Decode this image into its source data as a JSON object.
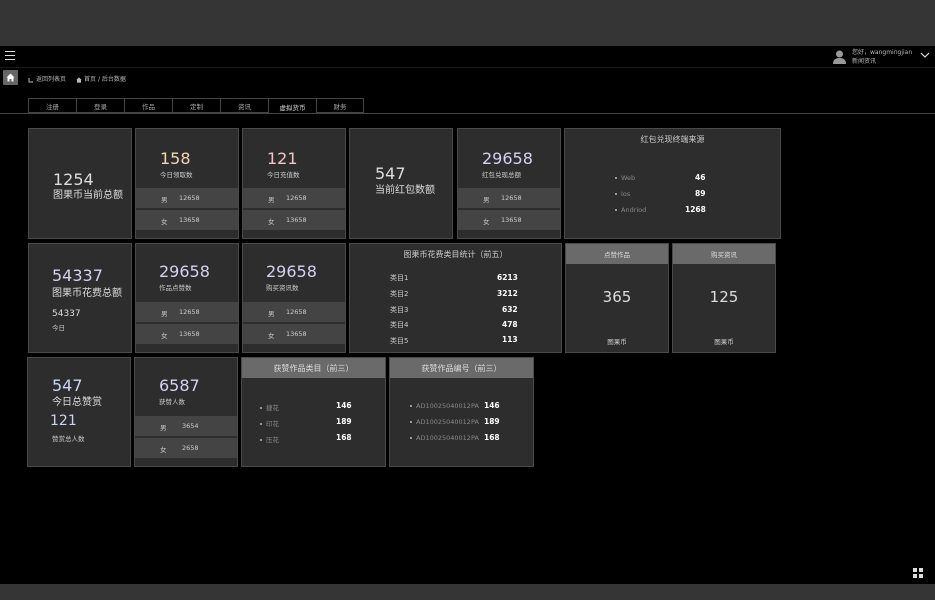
{
  "header": {
    "greeting": "您好，wangmingjian",
    "subtitle": "新闻资讯"
  },
  "breadcrumb": {
    "back": "返回列表页",
    "home": "首页",
    "separator": "/",
    "current": "后台数据"
  },
  "tabs": [
    "注册",
    "登录",
    "作品",
    "定制",
    "资讯",
    "虚拟货币",
    "财务"
  ],
  "cards": {
    "c1": {
      "value": "1254",
      "label": "图果币当前总额"
    },
    "c2": {
      "value": "158",
      "label": "今日领取数",
      "male_label": "男",
      "male": "12658",
      "female_label": "女",
      "female": "13658"
    },
    "c3": {
      "value": "121",
      "label": "今日充值数",
      "male_label": "男",
      "male": "12658",
      "female_label": "女",
      "female": "13658"
    },
    "c4": {
      "value": "547",
      "label": "当前红包数额"
    },
    "c5": {
      "value": "29658",
      "label": "红包兑现总额",
      "male_label": "男",
      "male": "12658",
      "female_label": "女",
      "female": "13658"
    },
    "c6": {
      "title": "红包兑现终端来源",
      "items": [
        {
          "name": "Web",
          "value": "46"
        },
        {
          "name": "Ios",
          "value": "89"
        },
        {
          "name": "Andriod",
          "value": "1268"
        }
      ]
    },
    "c7": {
      "value": "54337",
      "label": "图果币花费总额",
      "sub_value": "54337",
      "sub_label": "今日"
    },
    "c8": {
      "value": "29658",
      "label": "作品点赞数",
      "male_label": "男",
      "male": "12658",
      "female_label": "女",
      "female": "13658"
    },
    "c9": {
      "value": "29658",
      "label": "购买资讯数",
      "male_label": "男",
      "male": "12658",
      "female_label": "女",
      "female": "13658"
    },
    "c10": {
      "title": "图果币花费类目统计（前五）",
      "items": [
        {
          "name": "类目1",
          "value": "6213"
        },
        {
          "name": "类目2",
          "value": "3212"
        },
        {
          "name": "类目3",
          "value": "632"
        },
        {
          "name": "类目4",
          "value": "478"
        },
        {
          "name": "类目5",
          "value": "113"
        }
      ]
    },
    "c11": {
      "header": "点赞作品",
      "value": "365",
      "unit": "图果币"
    },
    "c12": {
      "header": "购买资讯",
      "value": "125",
      "unit": "图果币"
    },
    "c13": {
      "value": "547",
      "label": "今日总赞赏",
      "sub_value": "121",
      "sub_label": "赞赏总人数"
    },
    "c14": {
      "value": "6587",
      "label": "获赞人数",
      "male_label": "男",
      "male": "3654",
      "female_label": "女",
      "female": "2658"
    },
    "c15": {
      "title": "获赞作品类目（前三）",
      "items": [
        {
          "name": "捷花",
          "value": "146"
        },
        {
          "name": "印花",
          "value": "189"
        },
        {
          "name": "压花",
          "value": "168"
        }
      ]
    },
    "c16": {
      "title": "获赞作品编号（前三）",
      "items": [
        {
          "name": "AD10025040012PA",
          "value": "146"
        },
        {
          "name": "AD10025040012PA",
          "value": "189"
        },
        {
          "name": "AD10025040012PA",
          "value": "168"
        }
      ]
    }
  },
  "icons": [
    "menu-icon",
    "user-avatar-icon",
    "chevron-down-icon",
    "home-icon",
    "back-arrow-icon",
    "breadcrumb-home-icon",
    "grid-icon"
  ],
  "colors": {
    "background": "#000000",
    "card": "#2d2d2d",
    "card_border": "#4a4a4a",
    "row": "#444444",
    "header_strip": "#6a6a6a"
  }
}
